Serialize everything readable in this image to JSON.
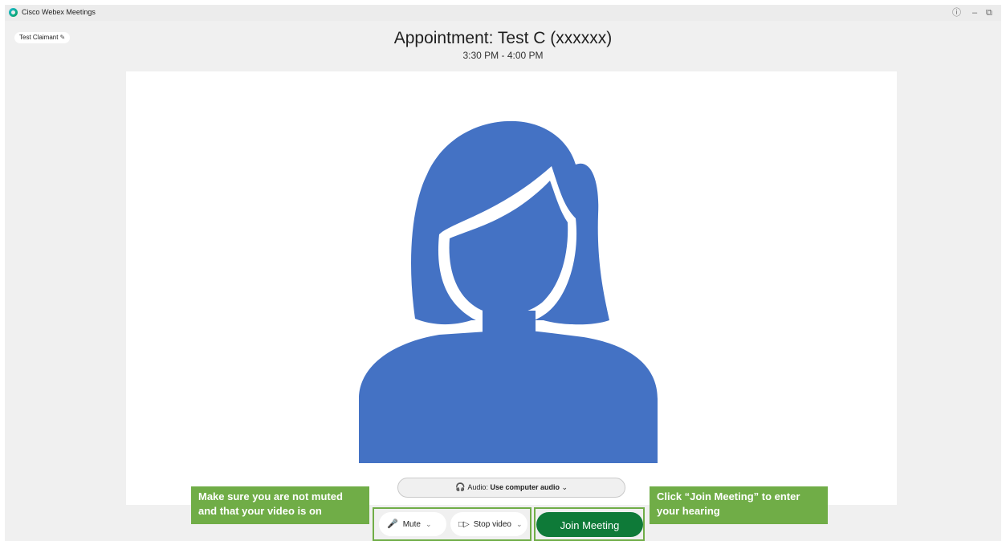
{
  "window": {
    "app_title": "Cisco Webex Meetings",
    "help_icon": "question-circle-icon",
    "minimize_icon": "minimize-icon",
    "restore_icon": "restore-icon"
  },
  "user": {
    "name": "Test Claimant",
    "edit_icon": "pencil-icon"
  },
  "meeting": {
    "title": "Appointment: Test C (xxxxxx)",
    "time": "3:30 PM - 4:00 PM"
  },
  "audio": {
    "label": "Audio: ",
    "value": "Use computer audio",
    "chevron": "⌄"
  },
  "controls": {
    "mute_label": "Mute",
    "stop_video_label": "Stop video",
    "join_label": "Join Meeting"
  },
  "annotations": {
    "left_note": "Make sure you are not muted and that your video is on",
    "right_note": "Click “Join Meeting” to enter your hearing"
  },
  "colors": {
    "avatar": "#4472c4",
    "annotation_green": "#70ad47",
    "join_button": "#0e7a38"
  }
}
